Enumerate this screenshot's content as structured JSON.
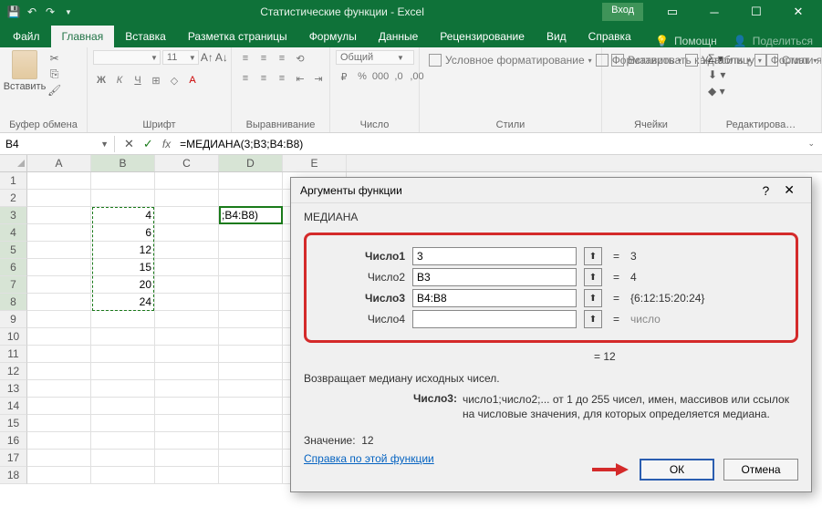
{
  "title": "Статистические функции  -  Excel",
  "login": "Вход",
  "tabs": [
    "Файл",
    "Главная",
    "Вставка",
    "Разметка страницы",
    "Формулы",
    "Данные",
    "Рецензирование",
    "Вид",
    "Справка"
  ],
  "activeTab": 1,
  "tabRight": {
    "help": "Помощн",
    "share": "Поделиться"
  },
  "ribbon": {
    "paste": "Вставить",
    "groups": [
      "Буфер обмена",
      "Шрифт",
      "Выравнивание",
      "Число",
      "Стили",
      "Ячейки",
      "Редактирова…"
    ],
    "fontName": "",
    "fontSize": "11",
    "numberFmt": "Общий",
    "styles": [
      "Условное форматирование",
      "Форматировать как таблицу",
      "Стили ячеек"
    ],
    "cells": [
      "Вставить",
      "Удалить",
      "Формат"
    ]
  },
  "namebox": "B4",
  "formula": "=МЕДИАНА(3;B3;B4:B8)",
  "cols": [
    "A",
    "B",
    "C",
    "D",
    "E"
  ],
  "rowCount": 18,
  "cells": {
    "B3": "4",
    "B4": "6",
    "B5": "12",
    "B6": "15",
    "B7": "20",
    "B8": "24",
    "D3": ";B4:B8)"
  },
  "marquee": {
    "top": "B3",
    "bottom": "B8"
  },
  "activeCell": "D3",
  "dlg": {
    "title": "Аргументы функции",
    "fn": "МЕДИАНА",
    "args": [
      {
        "label": "Число1",
        "bold": true,
        "value": "3",
        "result": "3"
      },
      {
        "label": "Число2",
        "bold": false,
        "value": "B3",
        "result": "4"
      },
      {
        "label": "Число3",
        "bold": true,
        "value": "B4:B8",
        "result": "{6:12:15:20:24}",
        "focus": true
      },
      {
        "label": "Число4",
        "bold": false,
        "value": "",
        "result": "число",
        "gray": true
      }
    ],
    "eqResult": "=  12",
    "desc": "Возвращает медиану исходных чисел.",
    "argK": "Число3:",
    "argV": "число1;число2;... от 1 до 255 чисел, имен, массивов или ссылок на числовые значения, для которых определяется медиана.",
    "valueLabel": "Значение:",
    "value": "12",
    "helpLink": "Справка по этой функции",
    "ok": "ОК",
    "cancel": "Отмена",
    "help": "?"
  }
}
